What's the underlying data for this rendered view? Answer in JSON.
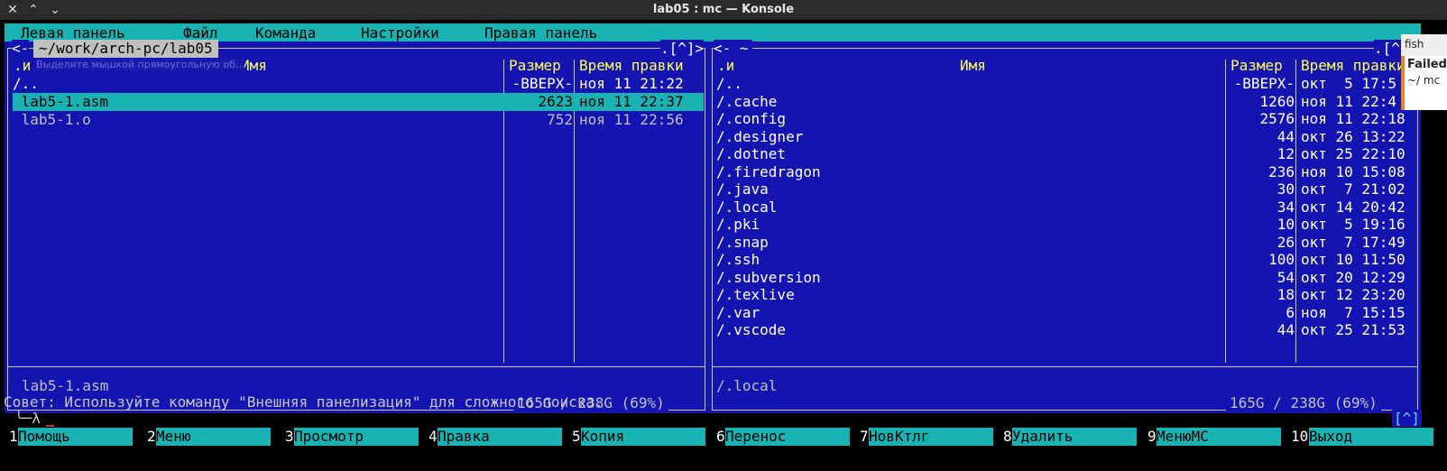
{
  "window": {
    "title": "lab05 : mc — Konsole",
    "close_glyph": "✕",
    "up_glyph": "⌃",
    "down_glyph": "⌄"
  },
  "menu": [
    "Левая панель",
    "Файл",
    "Команда",
    "Настройки",
    "Правая панель"
  ],
  "left_panel": {
    "nav_left": "<-",
    "path": "~/work/arch-pc/lab05",
    "nav_right": ".[^]>",
    "header_sort": ".и",
    "header_name": "Имя",
    "header_size": "Размер",
    "header_time": "Время правки",
    "tooltip": "Выделите мышкой прямоугольную об...",
    "rows": [
      {
        "name": "/..",
        "size": "-ВВЕРХ-",
        "time": "ноя 11 21:22"
      },
      {
        "name": " lab5-1.asm",
        "size": "2623",
        "time": "ноя 11 22:37"
      },
      {
        "name": " lab5-1.o",
        "size": "752",
        "time": "ноя 11 22:56"
      }
    ],
    "status_file": "lab5-1.asm",
    "disk": "165G / 238G (69%)"
  },
  "right_panel": {
    "nav_left": "<- ~",
    "nav_right": ".[^]>",
    "header_sort": ".и",
    "header_name": "Имя",
    "header_size": "Размер",
    "header_time": "Время правки",
    "rows": [
      {
        "name": "/..",
        "size": "-ВВЕРХ-",
        "time": "окт  5 17:5"
      },
      {
        "name": "/.cache",
        "size": "1260",
        "time": "ноя 11 22:4"
      },
      {
        "name": "/.config",
        "size": "2576",
        "time": "ноя 11 22:18"
      },
      {
        "name": "/.designer",
        "size": "44",
        "time": "окт 26 13:22"
      },
      {
        "name": "/.dotnet",
        "size": "12",
        "time": "окт 25 22:10"
      },
      {
        "name": "/.firedragon",
        "size": "236",
        "time": "ноя 10 15:08"
      },
      {
        "name": "/.java",
        "size": "30",
        "time": "окт  7 21:02"
      },
      {
        "name": "/.local",
        "size": "34",
        "time": "окт 14 20:42"
      },
      {
        "name": "/.pki",
        "size": "10",
        "time": "окт  5 19:16"
      },
      {
        "name": "/.snap",
        "size": "26",
        "time": "окт  7 17:49"
      },
      {
        "name": "/.ssh",
        "size": "100",
        "time": "окт 10 11:50"
      },
      {
        "name": "/.subversion",
        "size": "54",
        "time": "окт 20 12:29"
      },
      {
        "name": "/.texlive",
        "size": "18",
        "time": "окт 12 23:20"
      },
      {
        "name": "/.var",
        "size": "6",
        "time": "ноя  7 15:15"
      },
      {
        "name": "/.vscode",
        "size": "44",
        "time": "окт 25 21:53"
      }
    ],
    "status_file": "/.local",
    "disk": "165G / 238G (69%)"
  },
  "hint": "Совет: Используйте команду \"Внешняя панелизация\" для сложного поиска.",
  "prompt": "╰─λ",
  "caret_button": "[^]",
  "fkeys": [
    {
      "n": "1",
      "label": "Помощь"
    },
    {
      "n": "2",
      "label": "Меню"
    },
    {
      "n": "3",
      "label": "Просмотр"
    },
    {
      "n": "4",
      "label": "Правка"
    },
    {
      "n": "5",
      "label": "Копия"
    },
    {
      "n": "6",
      "label": "Перенос"
    },
    {
      "n": "7",
      "label": "НовКтлг"
    },
    {
      "n": "8",
      "label": "Удалить"
    },
    {
      "n": "9",
      "label": "МенюМС"
    },
    {
      "n": "10",
      "label": "Выход"
    }
  ],
  "notification": {
    "app": "fish",
    "title": "Failed",
    "text": "~/ mc"
  },
  "colors": {
    "panel_bg": "#1414b0",
    "cyan": "#19b3b3",
    "header_yellow": "#ffff55"
  }
}
